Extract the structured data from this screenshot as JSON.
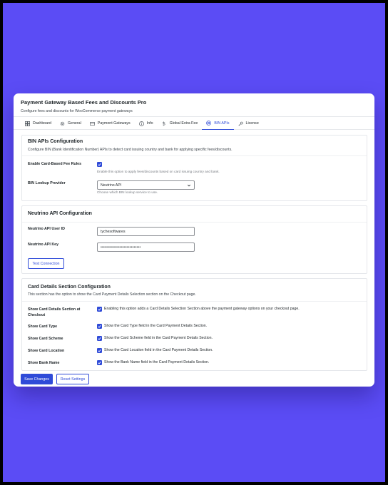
{
  "header": {
    "title": "Payment Gateway Based Fees and Discounts Pro",
    "subtitle": "Configure fees and discounts for WooCommerce payment gateways"
  },
  "tabs": [
    {
      "label": "Dashboard",
      "icon": "grid-icon"
    },
    {
      "label": "General",
      "icon": "gear-icon"
    },
    {
      "label": "Payment Gateways",
      "icon": "credit-card-icon"
    },
    {
      "label": "Info",
      "icon": "info-icon"
    },
    {
      "label": "Global Extra Fee",
      "icon": "dollar-icon"
    },
    {
      "label": "BIN APIs",
      "icon": "globe-icon",
      "active": true
    },
    {
      "label": "License",
      "icon": "key-icon"
    }
  ],
  "bin": {
    "title": "BIN APIs Configuration",
    "description": "Configure BIN (Bank Identification Number) APIs to detect card issuing country and bank for applying specific fees/discounts.",
    "enable_label": "Enable Card-Based Fee Rules",
    "enable_checked": true,
    "enable_help": "Enable this option to apply fees/discounts based on card issuing country and bank.",
    "provider_label": "BIN Lookup Provider",
    "provider_value": "Neutrino API",
    "provider_help": "Choose which BIN lookup service to use."
  },
  "neutrino": {
    "title": "Neutrino API Configuration",
    "user_id_label": "Neutrino API User ID",
    "user_id_value": "tychesoftwares",
    "key_label": "Neutrino API Key",
    "key_value": "••••••••••••••••••••••••••••",
    "test_button": "Test Connection"
  },
  "card_details": {
    "title": "Card Details Section Configuration",
    "description": "This section has the option to show the Card Payment Details Selection section on the Checkout page.",
    "rows": [
      {
        "label": "Show Card Details Section at Checkout",
        "text": "Enabling this option adds a Card Details Selection Section above the payment gateway options on your checkout page.",
        "checked": true
      },
      {
        "label": "Show Card Type",
        "text": "Show the Card Type field in the Card Payment Details Section.",
        "checked": true
      },
      {
        "label": "Show Card Scheme",
        "text": "Show the Card Scheme field in the Card Payment Details Section.",
        "checked": true
      },
      {
        "label": "Show Card Location",
        "text": "Show the Card Location field in the Card Payment Details Section.",
        "checked": true
      },
      {
        "label": "Show Bank Name",
        "text": "Show the Bank Name field in the Card Payment Details Section.",
        "checked": true
      }
    ]
  },
  "footer": {
    "save_label": "Save Changes",
    "reset_label": "Reset Settings"
  },
  "colors": {
    "background": "#5b4cf5",
    "accent": "#2f4bd8"
  }
}
